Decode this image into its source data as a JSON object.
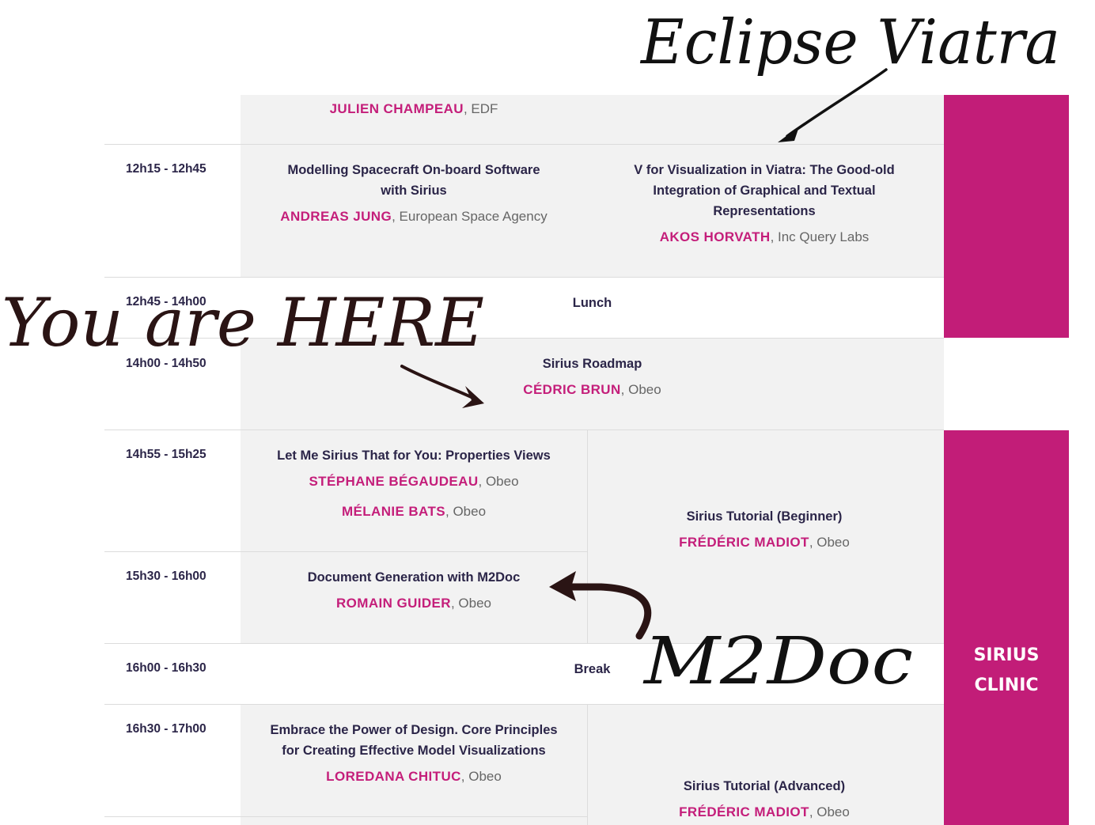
{
  "annotations": {
    "eclipse_viatra": "Eclipse Viatra",
    "you_are_here": "You are HERE",
    "m2doc": "M2Doc"
  },
  "schedule": {
    "row0": {
      "speakers": [
        {
          "name": "JULIEN CHAMPEAU",
          "org": ", EDF"
        }
      ]
    },
    "row1": {
      "time": "12h15 - 12h45",
      "left": {
        "title_line1": "Modelling Spacecraft On-board Software",
        "title_line2": "with Sirius",
        "speakers": [
          {
            "name": "ANDREAS JUNG",
            "org": ", European Space Agency"
          }
        ]
      },
      "right": {
        "title_line1": "V for Visualization in Viatra: The Good-old",
        "title_line2": "Integration of Graphical and Textual",
        "title_line3": "Representations",
        "speakers": [
          {
            "name": "AKOS HORVATH",
            "org": ", Inc Query Labs"
          }
        ]
      }
    },
    "row2": {
      "time": "12h45 - 14h00",
      "title": "Lunch"
    },
    "row3": {
      "time": "14h00 - 14h50",
      "title": "Sirius Roadmap",
      "speakers": [
        {
          "name": "CÉDRIC BRUN",
          "org": ", Obeo"
        }
      ]
    },
    "row4": {
      "time": "14h55 - 15h25",
      "title": "Let Me Sirius That for You: Properties Views",
      "speakers": [
        {
          "name": "STÉPHANE BÉGAUDEAU",
          "org": ", Obeo"
        },
        {
          "name": "MÉLANIE BATS",
          "org": ", Obeo"
        }
      ]
    },
    "tutorial_beginner": {
      "title": "Sirius Tutorial (Beginner)",
      "speakers": [
        {
          "name": "FRÉDÉRIC MADIOT",
          "org": ", Obeo"
        }
      ]
    },
    "row5": {
      "time": "15h30 - 16h00",
      "title": "Document Generation with M2Doc",
      "speakers": [
        {
          "name": "ROMAIN GUIDER",
          "org": ", Obeo"
        }
      ]
    },
    "row6": {
      "time": "16h00 - 16h30",
      "title": "Break"
    },
    "row7": {
      "time": "16h30 - 17h00",
      "title_line1": "Embrace the Power of Design. Core Principles",
      "title_line2": "for Creating Effective Model Visualizations",
      "speakers": [
        {
          "name": "LOREDANA CHITUC",
          "org": ", Obeo"
        }
      ]
    },
    "tutorial_advanced": {
      "title": "Sirius Tutorial (Advanced)",
      "speakers": [
        {
          "name": "FRÉDÉRIC MADIOT",
          "org": ", Obeo"
        }
      ]
    },
    "sirius_clinic": {
      "line1": "SIRIUS",
      "line2": "CLINIC"
    }
  },
  "colors": {
    "accent_magenta": "#c21d78",
    "speaker_name": "#c41e7a",
    "title_text": "#2b2548",
    "cell_background": "#f2f2f2",
    "handwriting": "#1a1212"
  }
}
